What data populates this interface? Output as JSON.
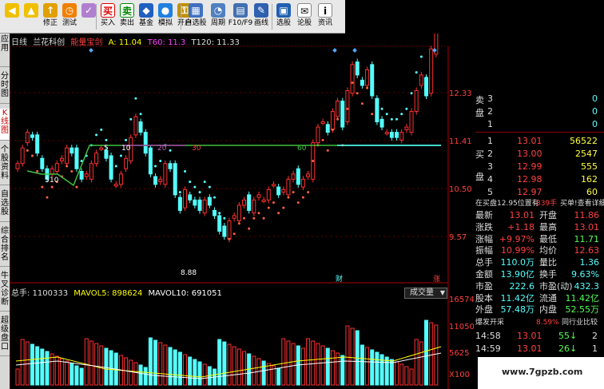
{
  "toolbar": {
    "buttons": [
      {
        "id": "back",
        "label": "",
        "icon": "back-arrow-icon"
      },
      {
        "id": "up",
        "label": "",
        "icon": "up-arrow-icon"
      },
      {
        "id": "modify",
        "label": "修正",
        "icon": "modify-icon"
      },
      {
        "id": "test",
        "label": "测试",
        "icon": "test-icon"
      },
      {
        "id": "buy",
        "label": "买入",
        "icon": "buy-icon",
        "icon_text": "买"
      },
      {
        "id": "sell",
        "label": "卖出",
        "icon": "sell-icon",
        "icon_text": "卖"
      },
      {
        "id": "fund",
        "label": "基金",
        "icon": "fund-icon"
      },
      {
        "id": "simulate",
        "label": "模拟",
        "icon": "simulate-icon"
      },
      {
        "id": "open",
        "label": "开户",
        "icon": "lock-icon"
      },
      {
        "id": "watchlist",
        "label": "自选股",
        "icon": "watchlist-icon"
      },
      {
        "id": "cycle",
        "label": "周期",
        "icon": "clock-icon"
      },
      {
        "id": "f10",
        "label": "F10/F9",
        "icon": "f10-icon"
      },
      {
        "id": "draw",
        "label": "画线",
        "icon": "pen-icon"
      },
      {
        "id": "select",
        "label": "选股",
        "icon": "select-stock-icon"
      },
      {
        "id": "notes",
        "label": "论股",
        "icon": "notes-icon"
      },
      {
        "id": "info",
        "label": "资讯",
        "icon": "info-icon"
      }
    ]
  },
  "left_tabs": [
    "应用",
    "分时图",
    "K线图",
    "个股资料",
    "自选股",
    "综合排名",
    "牛叉诊断",
    "超级盘口"
  ],
  "chart_header": {
    "period": "日线",
    "stock": "兰花科创",
    "indicator": "能量宝剑",
    "a_label": "A: 11.04",
    "t120_label": "T120: 11.33",
    "t60_label": "T60: 11.3"
  },
  "price_axis": [
    "12.33",
    "11.41",
    "10.50",
    "9.57"
  ],
  "volume_axis": [
    "16574",
    "11050",
    "5625",
    "X100"
  ],
  "chart_labels": {
    "low_price": "8.88",
    "marker_cai": "财",
    "marker_zhang": "涨",
    "num_5": "5",
    "num_10": "10",
    "num_20": "20",
    "num_30": "30",
    "num_60": "60",
    "num_5b": "5",
    "num_10b": "10"
  },
  "volume_header": {
    "total": "总手: 1100333",
    "mavol5": "MAVOL5: 898624",
    "mavol10": "MAVOL10: 691051",
    "dropdown": "成交量"
  },
  "chart_data": {
    "type": "candlestick",
    "series": [
      {
        "name": "MAVOL5",
        "value": 898624
      },
      {
        "name": "MAVOL10",
        "value": 691051
      }
    ],
    "price_ticks": [
      12.33,
      11.41,
      10.5,
      9.57
    ],
    "volume_ticks": [
      16574,
      11050,
      5625
    ],
    "last_close": 13.01,
    "low": 8.88
  },
  "panel": {
    "sell_label": "卖",
    "sell_label2": "盘",
    "buy_label": "买",
    "buy_label2": "盘",
    "sell_rows": [
      {
        "lvl": "3",
        "price": "",
        "vol": "0"
      },
      {
        "lvl": "2",
        "price": "",
        "vol": "0"
      },
      {
        "lvl": "1",
        "price": "",
        "vol": "0"
      }
    ],
    "buy_rows": [
      {
        "lvl": "1",
        "price": "13.01",
        "vol": "56522"
      },
      {
        "lvl": "2",
        "price": "13.00",
        "vol": "2547"
      },
      {
        "lvl": "3",
        "price": "12.99",
        "vol": "555"
      },
      {
        "lvl": "4",
        "price": "12.98",
        "vol": "162"
      },
      {
        "lvl": "5",
        "price": "12.97",
        "vol": "60"
      }
    ],
    "queue_line": "在买盘12.95位置有",
    "queue_count": "839手",
    "queue_link": "买单!查看详细",
    "stats": [
      {
        "k1": "最新",
        "v1": "13.01",
        "k2": "开盘",
        "v2": "11.86"
      },
      {
        "k1": "涨跌",
        "v1": "+1.18",
        "k2": "最高",
        "v2": "13.01"
      },
      {
        "k1": "涨幅",
        "v1": "+9.97%",
        "k2": "最低",
        "v2": "11.71"
      },
      {
        "k1": "振幅",
        "v1": "10.99%",
        "k2": "均价",
        "v2": "12.63"
      },
      {
        "k1": "总手",
        "v1": "110.0万",
        "k2": "量比",
        "v2": "1.36"
      },
      {
        "k1": "金额",
        "v1": "13.90亿",
        "k2": "换手",
        "v2": "9.63%"
      },
      {
        "k1": "市盈",
        "v1": "222.6",
        "k2": "市盈(动)",
        "v2": "432.3"
      },
      {
        "k1": "股本",
        "v1": "11.42亿",
        "k2": "流通",
        "v2": "11.42亿"
      },
      {
        "k1": "外盘",
        "v1": "57.48万",
        "k2": "内盘",
        "v2": "52.55万"
      }
    ],
    "burst_label": "爆发开采",
    "burst_pct": "8.59%",
    "industry_link": "同行业比较",
    "ticks": [
      {
        "time": "14:58",
        "price": "13.01",
        "vol": "55",
        "dir": "down",
        "n": "2"
      },
      {
        "time": "14:59",
        "price": "13.01",
        "vol": "26",
        "dir": "down",
        "n": "1"
      }
    ]
  },
  "watermark": "www.7gpzb.com",
  "colors": {
    "up": "#ff3030",
    "down": "#54ffff",
    "yellow": "#ffff00",
    "white": "#ffffff",
    "label": "#c0c0c0"
  }
}
